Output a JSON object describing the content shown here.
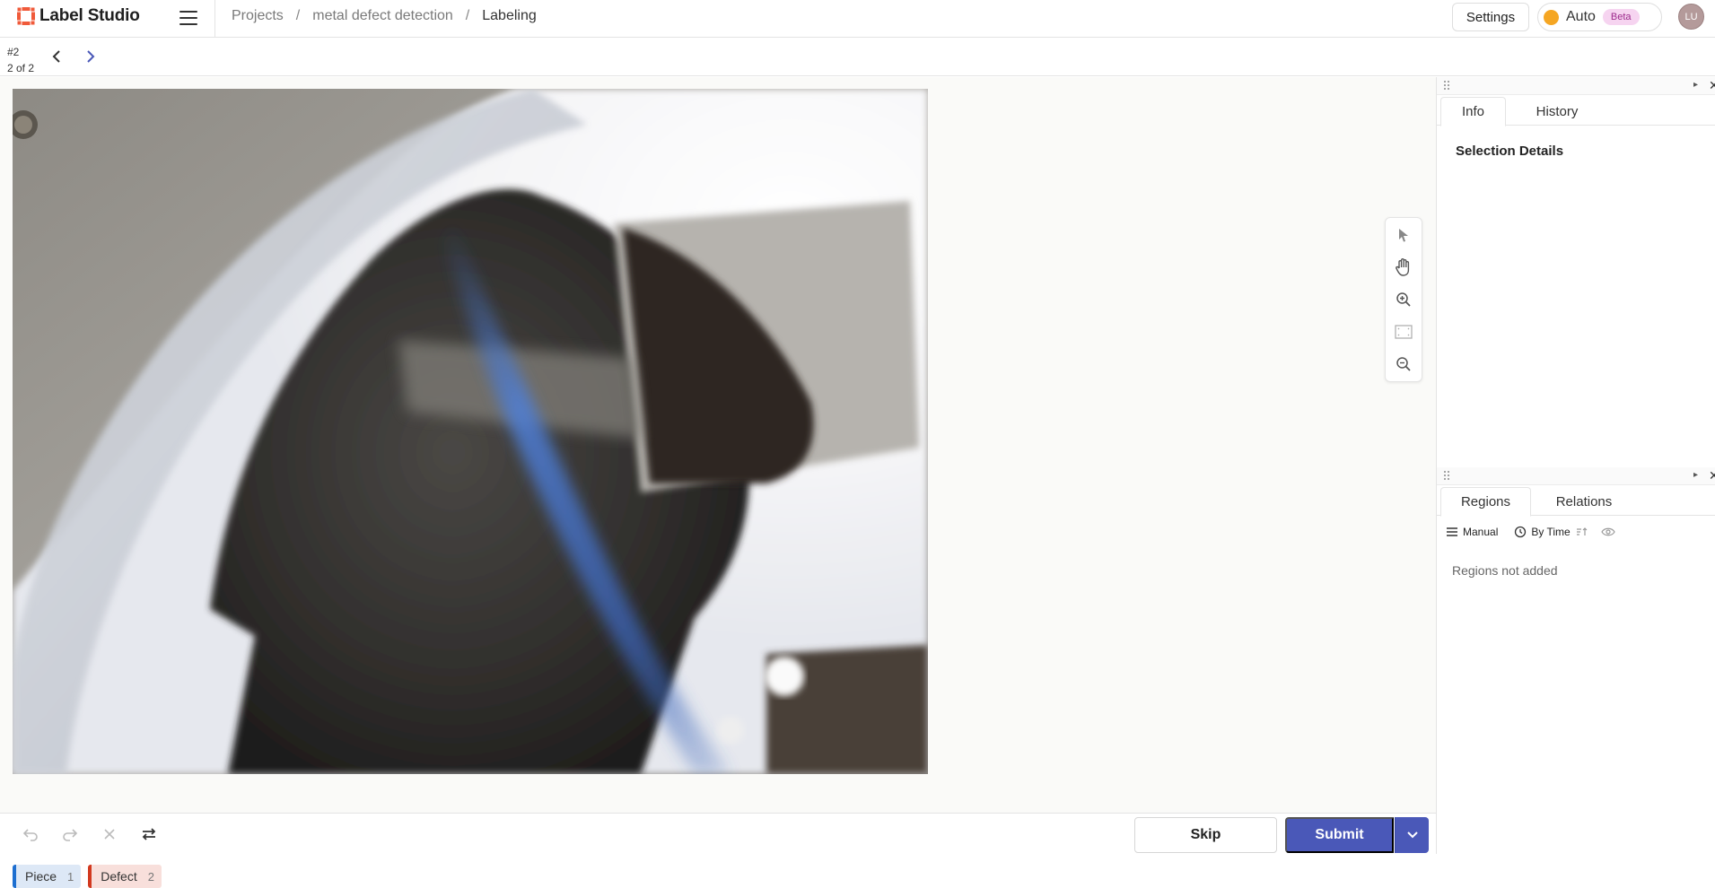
{
  "app": {
    "name": "Label Studio"
  },
  "breadcrumb": [
    {
      "label": "Projects"
    },
    {
      "label": "metal defect detection"
    },
    {
      "label": "Labeling"
    }
  ],
  "header": {
    "settings_label": "Settings",
    "auto_label": "Auto",
    "beta_label": "Beta",
    "avatar_initials": "LU"
  },
  "task": {
    "id": "#2",
    "position": "2 of 2"
  },
  "tools": [
    "pointer-icon",
    "hand-icon",
    "zoom-in-icon",
    "zoom-to-fit-icon",
    "zoom-out-icon"
  ],
  "labels": [
    {
      "name": "Piece",
      "hotkey": "1",
      "color": "#1e6fd0"
    },
    {
      "name": "Defect",
      "hotkey": "2",
      "color": "#d2391f"
    }
  ],
  "actions": {
    "skip_label": "Skip",
    "submit_label": "Submit"
  },
  "info_panel": {
    "tabs": [
      {
        "label": "Info"
      },
      {
        "label": "History"
      }
    ],
    "selection_title": "Selection Details"
  },
  "regions_panel": {
    "tabs": [
      {
        "label": "Regions"
      },
      {
        "label": "Relations"
      }
    ],
    "group_label": "Manual",
    "sort_label": "By Time",
    "empty_text": "Regions not added"
  },
  "colors": {
    "accent": "#4a58b8",
    "brand": "#f05a3a"
  }
}
